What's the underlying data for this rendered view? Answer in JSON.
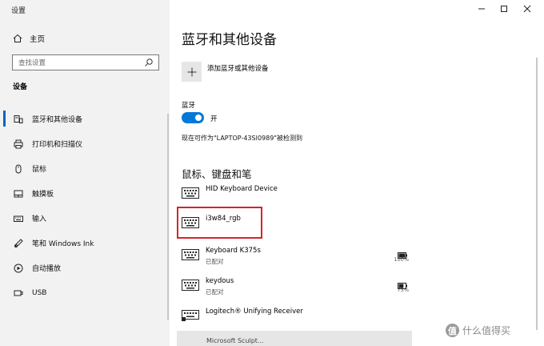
{
  "window": {
    "title": "设置"
  },
  "sidebar": {
    "home_label": "主页",
    "search_placeholder": "查找设置",
    "section_label": "设备",
    "items": [
      {
        "label": "蓝牙和其他设备",
        "icon": "bluetooth-devices-icon",
        "active": true
      },
      {
        "label": "打印机和扫描仪",
        "icon": "printer-icon"
      },
      {
        "label": "鼠标",
        "icon": "mouse-icon"
      },
      {
        "label": "触摸板",
        "icon": "touchpad-icon"
      },
      {
        "label": "输入",
        "icon": "keyboard-icon"
      },
      {
        "label": "笔和 Windows Ink",
        "icon": "pen-icon"
      },
      {
        "label": "自动播放",
        "icon": "autoplay-icon"
      },
      {
        "label": "USB",
        "icon": "usb-icon"
      }
    ]
  },
  "main": {
    "title": "蓝牙和其他设备",
    "add_device_label": "添加蓝牙或其他设备",
    "bluetooth_label": "蓝牙",
    "bluetooth_toggle": {
      "state": "开",
      "on": true
    },
    "discoverable_text": "现在可作为\"LAPTOP-43SI0989\"被检测到",
    "group_title": "鼠标、键盘和笔",
    "devices": [
      {
        "name": "HID Keyboard Device",
        "status": "",
        "battery": ""
      },
      {
        "name": "i3w84_rgb",
        "status": "",
        "battery": "",
        "highlighted": true
      },
      {
        "name": "Keyboard K375s",
        "status": "已配对",
        "battery": "100%",
        "battery_level": 1.0
      },
      {
        "name": "keydous",
        "status": "已配对",
        "battery": "73%",
        "battery_level": 0.73
      },
      {
        "name": "Logitech® Unifying Receiver",
        "status": "",
        "battery": ""
      }
    ],
    "clipped_text": "Microsoft Sculpt..."
  },
  "watermark": {
    "badge": "值",
    "text": "什么值得买"
  },
  "colors": {
    "accent": "#0078d7",
    "highlight": "#d6242a",
    "sidebar_bg": "#f2f2f2"
  }
}
